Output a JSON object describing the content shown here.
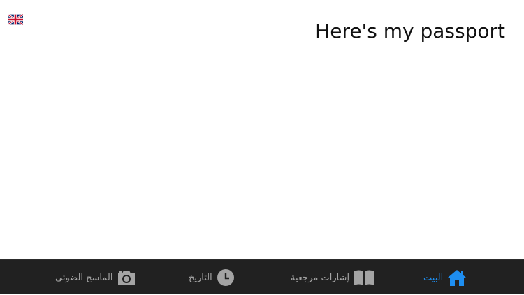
{
  "header": {
    "language_flag_icon": "uk-flag-icon",
    "phrase": "Here's my passport"
  },
  "tabbar": {
    "active_color": "#1e8ef0",
    "inactive_color": "#a4a4a4",
    "items": [
      {
        "label": "البيت",
        "icon": "home-icon",
        "active": true
      },
      {
        "label": "إشارات مرجعية",
        "icon": "book-icon",
        "active": false
      },
      {
        "label": "التاريخ",
        "icon": "clock-icon",
        "active": false
      },
      {
        "label": "الماسح الضوئي",
        "icon": "camera-icon",
        "active": false
      }
    ]
  }
}
